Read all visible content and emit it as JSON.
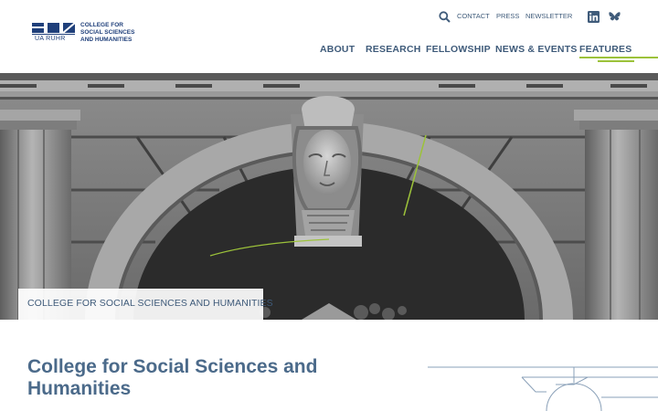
{
  "logo": {
    "university": "UA RUHR",
    "line1": "COLLEGE FOR",
    "line2": "SOCIAL SCIENCES",
    "line3": "AND HUMANITIES"
  },
  "utility_nav": {
    "search_icon": "search-icon",
    "items": [
      "CONTACT",
      "PRESS",
      "NEWSLETTER"
    ],
    "social": [
      "linkedin-icon",
      "bluesky-icon"
    ]
  },
  "main_nav": {
    "items": [
      "ABOUT",
      "RESEARCH",
      "FELLOWSHIP",
      "NEWS & EVENTS",
      "FEATURES"
    ],
    "active": "FEATURES"
  },
  "hero": {
    "caption": "COLLEGE FOR SOCIAL SCIENCES AND HUMANITIES"
  },
  "main": {
    "title": "College for Social Sciences and Humanities"
  },
  "colors": {
    "primary": "#3f5b7a",
    "logo_blue": "#1f3f7a",
    "accent_green": "#9cc23a"
  }
}
